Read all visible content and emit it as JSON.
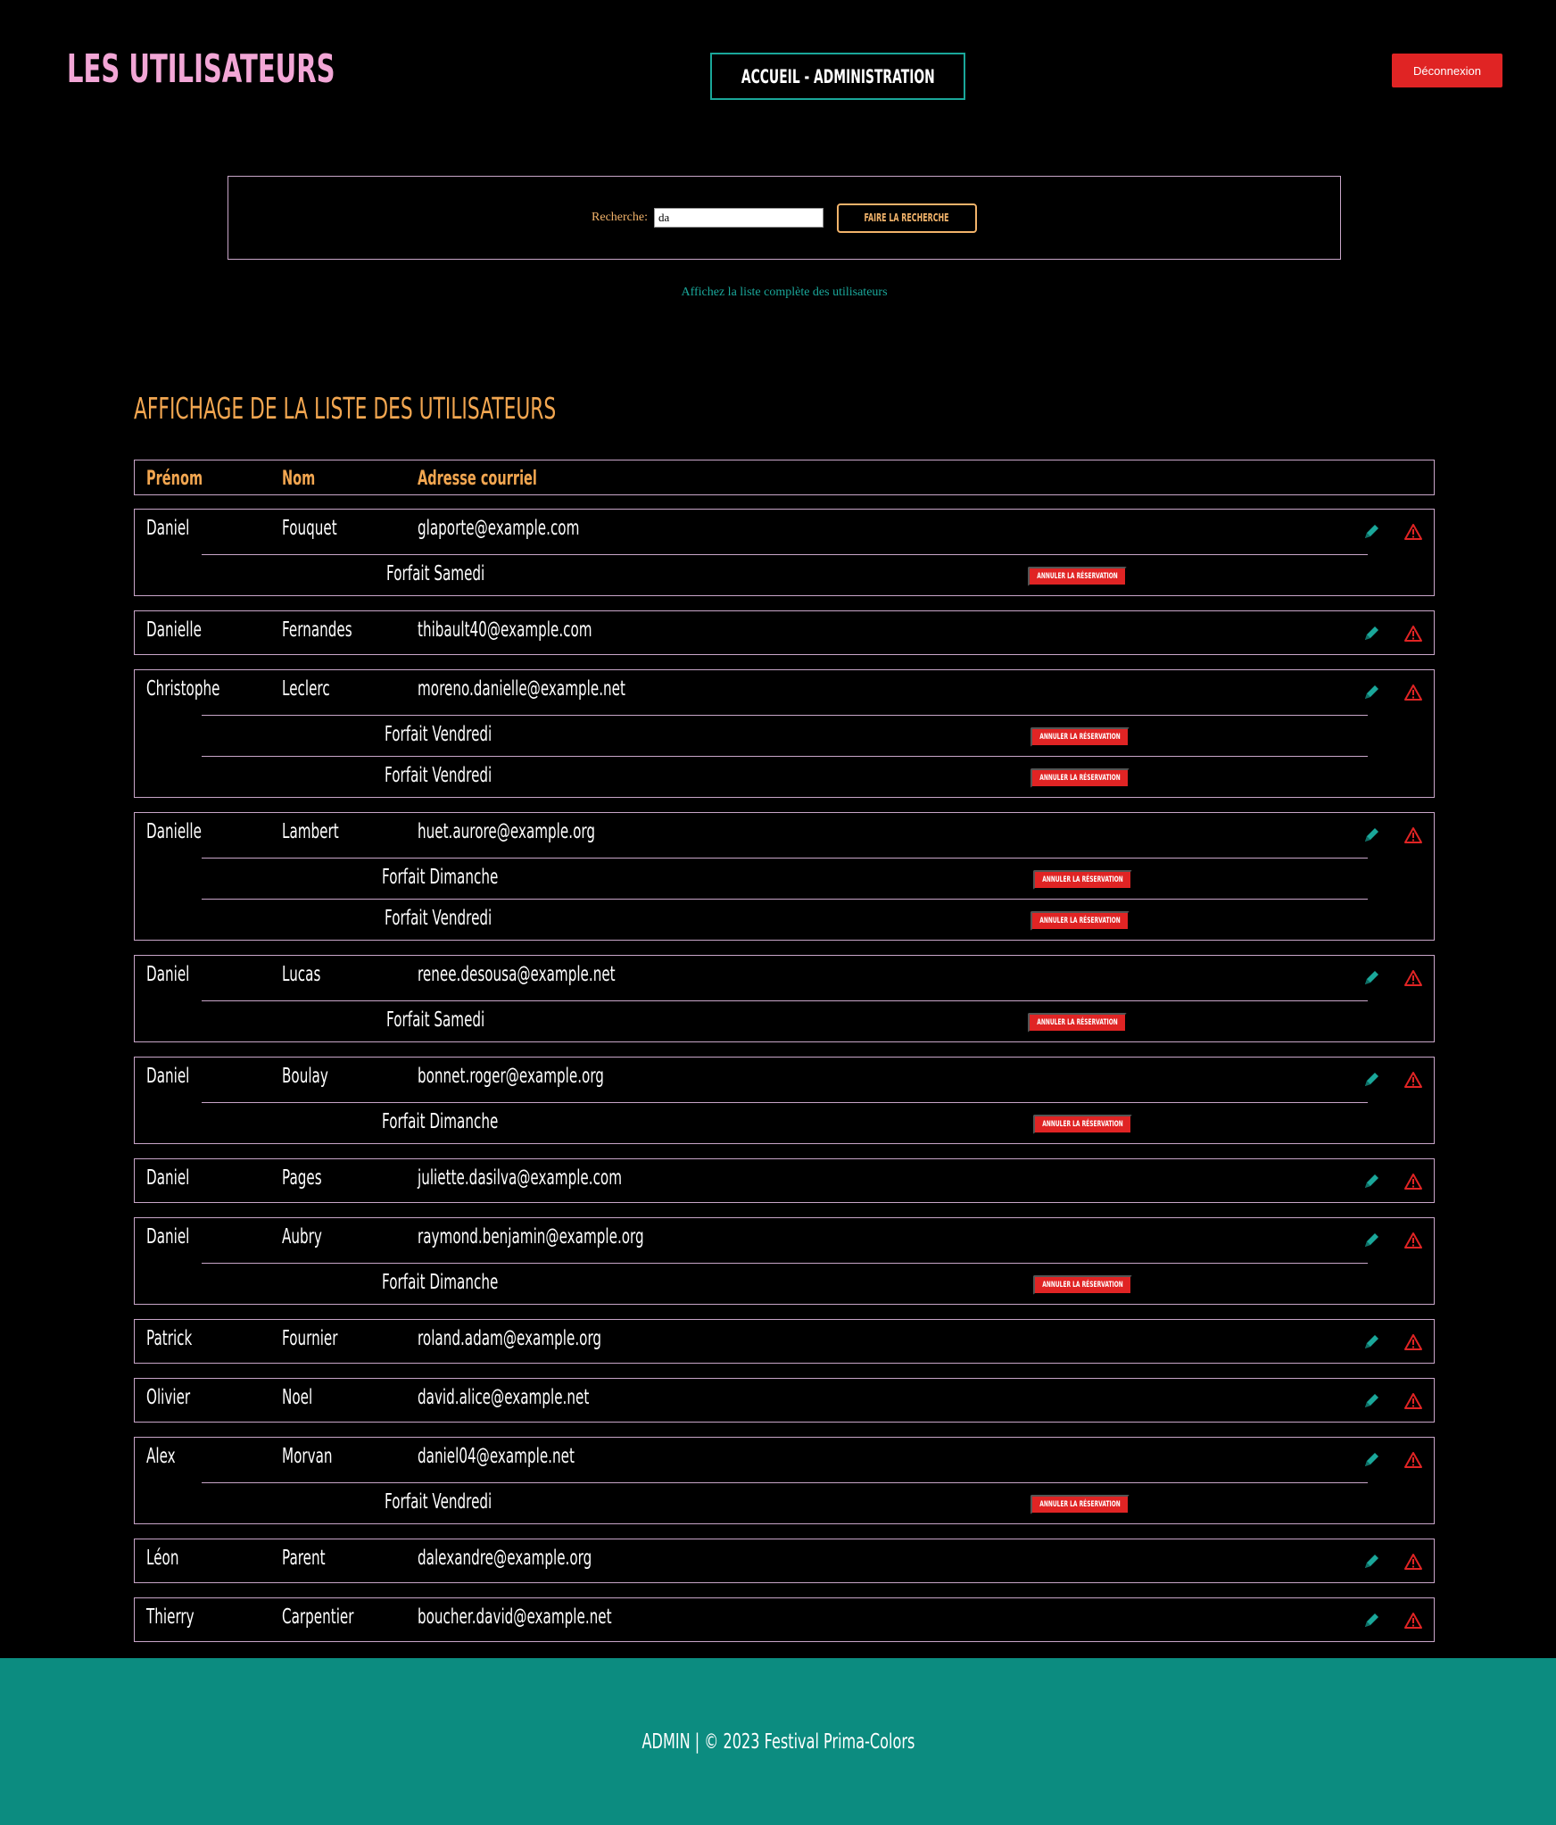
{
  "header": {
    "title": "LES UTILISATEURS",
    "nav_label": "ACCUEIL - ADMINISTRATION",
    "logout_label": "Déconnexion"
  },
  "search": {
    "label": "Recherche:",
    "value": "da",
    "button_label": "FAIRE LA RECHERCHE",
    "full_list_link": "Affichez la liste complète des utilisateurs"
  },
  "section_title": "AFFICHAGE DE LA LISTE DES UTILISATEURS",
  "table": {
    "columns": [
      "Prénom",
      "Nom",
      "Adresse courriel"
    ],
    "cancel_label": "ANNULER LA RÉSERVATION",
    "rows": [
      {
        "prenom": "Daniel",
        "nom": "Fouquet",
        "email": "glaporte@example.com",
        "forfaits": [
          "Forfait Samedi"
        ]
      },
      {
        "prenom": "Danielle",
        "nom": "Fernandes",
        "email": "thibault40@example.com",
        "forfaits": []
      },
      {
        "prenom": "Christophe",
        "nom": "Leclerc",
        "email": "moreno.danielle@example.net",
        "forfaits": [
          "Forfait Vendredi",
          "Forfait Vendredi"
        ]
      },
      {
        "prenom": "Danielle",
        "nom": "Lambert",
        "email": "huet.aurore@example.org",
        "forfaits": [
          "Forfait Dimanche",
          "Forfait Vendredi"
        ]
      },
      {
        "prenom": "Daniel",
        "nom": "Lucas",
        "email": "renee.desousa@example.net",
        "forfaits": [
          "Forfait Samedi"
        ]
      },
      {
        "prenom": "Daniel",
        "nom": "Boulay",
        "email": "bonnet.roger@example.org",
        "forfaits": [
          "Forfait Dimanche"
        ]
      },
      {
        "prenom": "Daniel",
        "nom": "Pages",
        "email": "juliette.dasilva@example.com",
        "forfaits": []
      },
      {
        "prenom": "Daniel",
        "nom": "Aubry",
        "email": "raymond.benjamin@example.org",
        "forfaits": [
          "Forfait Dimanche"
        ]
      },
      {
        "prenom": "Patrick",
        "nom": "Fournier",
        "email": "roland.adam@example.org",
        "forfaits": []
      },
      {
        "prenom": "Olivier",
        "nom": "Noel",
        "email": "david.alice@example.net",
        "forfaits": []
      },
      {
        "prenom": "Alex",
        "nom": "Morvan",
        "email": "daniel04@example.net",
        "forfaits": [
          "Forfait Vendredi"
        ]
      },
      {
        "prenom": "Léon",
        "nom": "Parent",
        "email": "dalexandre@example.org",
        "forfaits": []
      },
      {
        "prenom": "Thierry",
        "nom": "Carpentier",
        "email": "boucher.david@example.net",
        "forfaits": []
      }
    ]
  },
  "footer": "ADMIN | © 2023 Festival Prima-Colors",
  "colors": {
    "title_pink": "#f2a6d6",
    "accent_orange": "#f2a650",
    "teal": "#1aa79a",
    "danger_red": "#e02424",
    "footer_bg": "#0c8c80"
  },
  "icons": {
    "edit": "pencil-icon",
    "delete": "warning-triangle-icon"
  }
}
